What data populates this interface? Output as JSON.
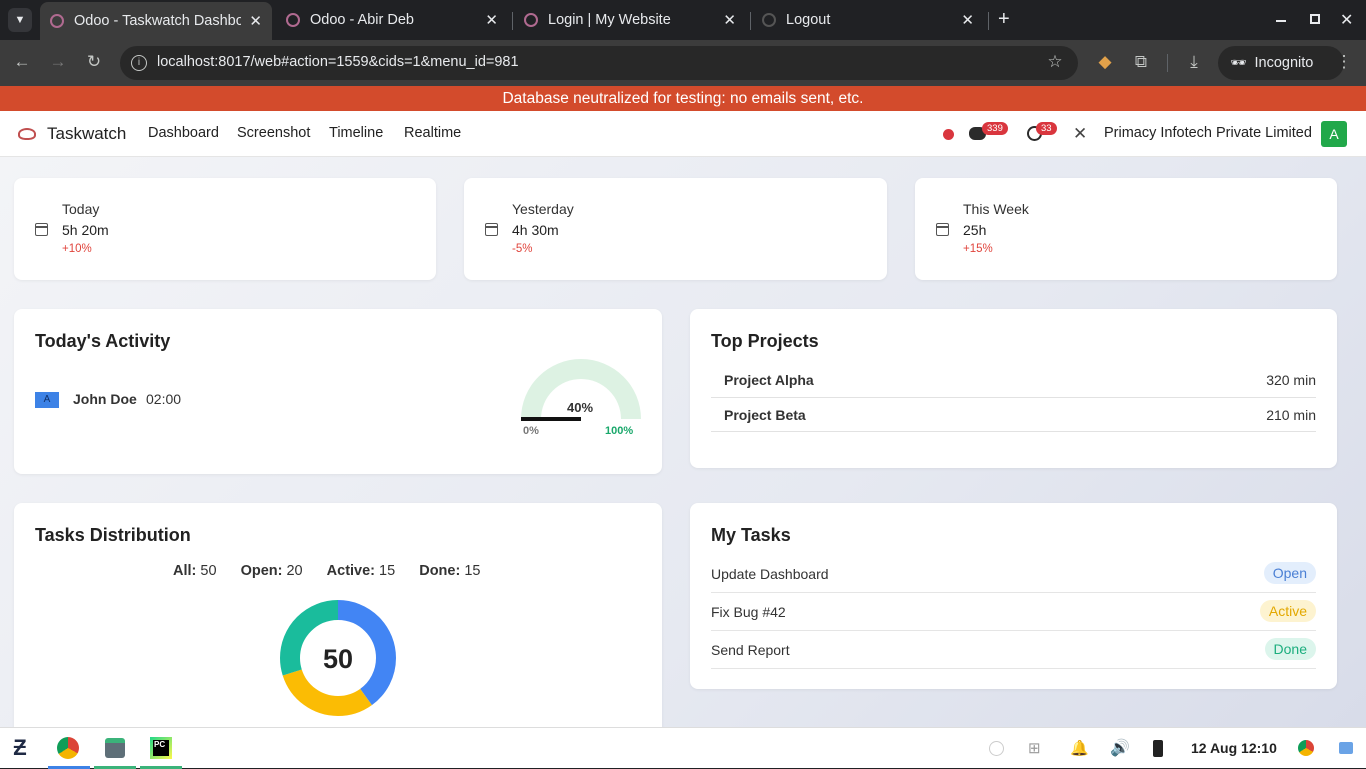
{
  "browser": {
    "tabs": [
      {
        "title": "Odoo - Taskwatch Dashboard",
        "active": true
      },
      {
        "title": "Odoo - Abir Deb",
        "active": false
      },
      {
        "title": "Login | My Website",
        "active": false
      },
      {
        "title": "Logout",
        "active": false
      }
    ],
    "url": "localhost:8017/web#action=1559&cids=1&menu_id=981",
    "incognito_label": "Incognito"
  },
  "banner": "Database neutralized for testing: no emails sent, etc.",
  "navbar": {
    "app_name": "Taskwatch",
    "menu": [
      "Dashboard",
      "Screenshot",
      "Timeline",
      "Realtime"
    ],
    "messages_count": "339",
    "activities_count": "33",
    "company": "Primacy Infotech Private Limited",
    "avatar_letter": "A",
    "colors": {
      "status_dot": "#d9363e",
      "avatar_bg": "#21a84a"
    }
  },
  "stats": [
    {
      "title": "Today",
      "value": "5h 20m",
      "change": "+10%"
    },
    {
      "title": "Yesterday",
      "value": "4h 30m",
      "change": "-5%"
    },
    {
      "title": "This Week",
      "value": "25h",
      "change": "+15%"
    }
  ],
  "activity": {
    "title": "Today's Activity",
    "avatar": "A",
    "user": "John Doe",
    "time": "02:00",
    "gauge": {
      "value_label": "40%",
      "value": 40,
      "min_label": "0%",
      "max_label": "100%"
    }
  },
  "projects": {
    "title": "Top Projects",
    "rows": [
      {
        "name": "Project Alpha",
        "value": "320 min"
      },
      {
        "name": "Project Beta",
        "value": "210 min"
      }
    ]
  },
  "distribution": {
    "title": "Tasks Distribution",
    "legend": [
      {
        "label": "All:",
        "value": "50"
      },
      {
        "label": "Open:",
        "value": "20"
      },
      {
        "label": "Active:",
        "value": "15"
      },
      {
        "label": "Done:",
        "value": "15"
      }
    ],
    "center": "50",
    "segments": [
      {
        "value": 20,
        "color": "#4285f4"
      },
      {
        "value": 15,
        "color": "#fbbc04"
      },
      {
        "value": 15,
        "color": "#1abc9c"
      }
    ]
  },
  "tasks": {
    "title": "My Tasks",
    "rows": [
      {
        "name": "Update Dashboard",
        "status": "Open",
        "bg": "#e3eefc",
        "fg": "#4a7fd4"
      },
      {
        "name": "Fix Bug #42",
        "status": "Active",
        "bg": "#fdf3d0",
        "fg": "#e3a800"
      },
      {
        "name": "Send Report",
        "status": "Done",
        "bg": "#dcf5ec",
        "fg": "#1cae7e"
      }
    ]
  },
  "taskbar": {
    "datetime": "12 Aug 12:10"
  }
}
